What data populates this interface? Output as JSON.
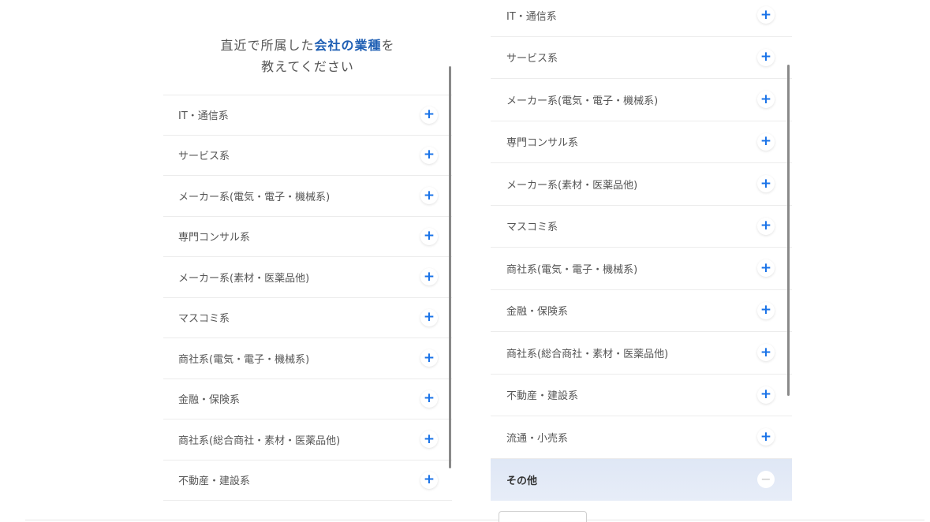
{
  "question": {
    "line1_prefix": "直近で所属した",
    "line1_highlight": "会社の業種",
    "line1_suffix": "を",
    "line2": "教えてください"
  },
  "left_items": [
    {
      "label": "IT・通信系"
    },
    {
      "label": "サービス系"
    },
    {
      "label": "メーカー系(電気・電子・機械系)"
    },
    {
      "label": "専門コンサル系"
    },
    {
      "label": "メーカー系(素材・医薬品他)"
    },
    {
      "label": "マスコミ系"
    },
    {
      "label": "商社系(電気・電子・機械系)"
    },
    {
      "label": "金融・保険系"
    },
    {
      "label": "商社系(総合商社・素材・医薬品他)"
    },
    {
      "label": "不動産・建設系"
    }
  ],
  "right_items": [
    {
      "label": "IT・通信系"
    },
    {
      "label": "サービス系"
    },
    {
      "label": "メーカー系(電気・電子・機械系)"
    },
    {
      "label": "専門コンサル系"
    },
    {
      "label": "メーカー系(素材・医薬品他)"
    },
    {
      "label": "マスコミ系"
    },
    {
      "label": "商社系(電気・電子・機械系)"
    },
    {
      "label": "金融・保険系"
    },
    {
      "label": "商社系(総合商社・素材・医薬品他)"
    },
    {
      "label": "不動産・建設系"
    },
    {
      "label": "流通・小売系"
    }
  ],
  "right_selected": {
    "label": "その他"
  },
  "icons": {
    "plus": "+",
    "minus": "−"
  },
  "colors": {
    "accent": "#1a73e8",
    "highlight_text": "#1f5fb4",
    "selected_bg": "#e2e9f6"
  }
}
